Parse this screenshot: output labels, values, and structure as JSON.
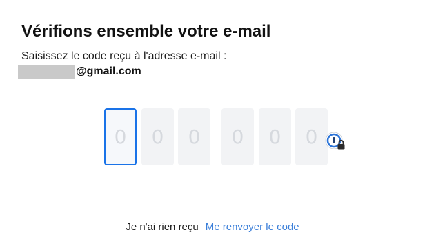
{
  "header": {
    "title": "Vérifions ensemble votre e-mail",
    "instruction": "Saisissez le code reçu à l'adresse e-mail :",
    "email_visible_part": "@gmail.com"
  },
  "code_input": {
    "digits": [
      {
        "placeholder": "0"
      },
      {
        "placeholder": "0"
      },
      {
        "placeholder": "0"
      },
      {
        "placeholder": "0"
      },
      {
        "placeholder": "0"
      },
      {
        "placeholder": "0"
      }
    ],
    "active_index": 0
  },
  "password_manager": {
    "icon": "password-manager-lock-icon"
  },
  "footer": {
    "no_code_text": "Je n'ai rien reçu",
    "resend_label": "Me renvoyer le code"
  },
  "colors": {
    "accent": "#1a73e8",
    "link": "#3b7fd9",
    "box_bg": "#f2f3f5",
    "placeholder": "#d6d9de",
    "redaction": "#c9c9c9"
  }
}
